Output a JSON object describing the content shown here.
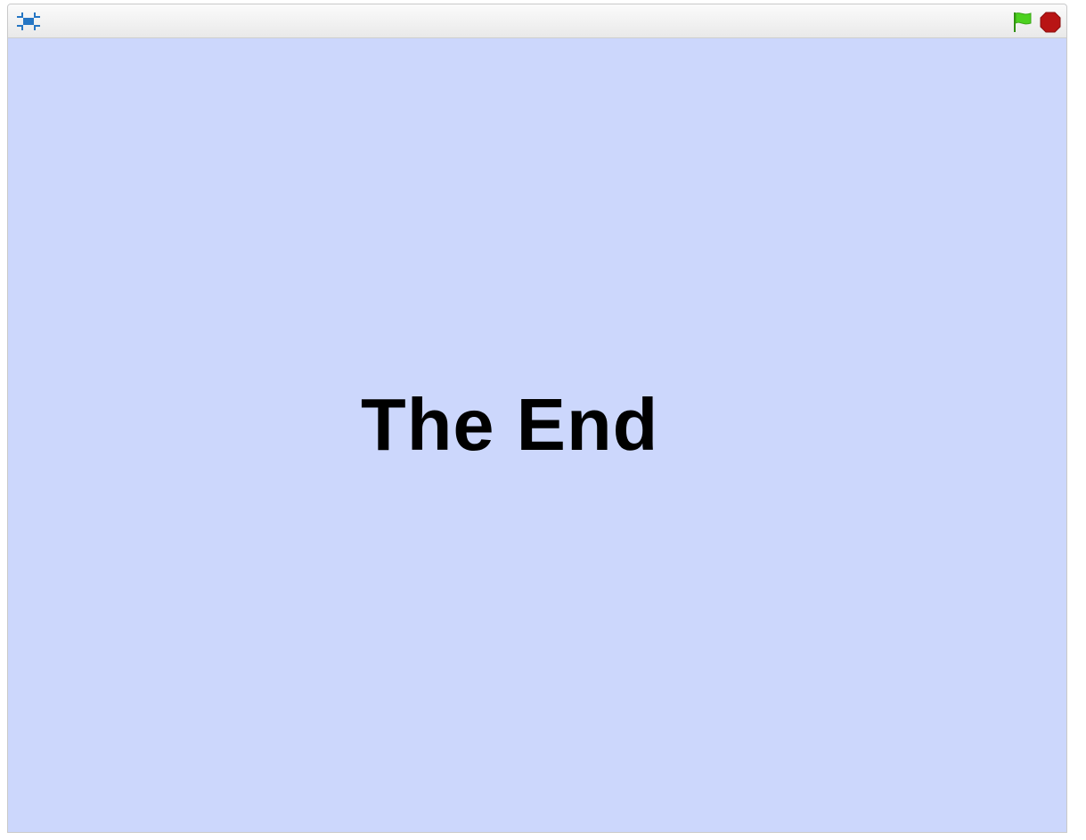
{
  "player": {
    "toolbar": {
      "fullscreen_icon": "fullscreen-icon",
      "green_flag_icon": "green-flag-icon",
      "stop_icon": "stop-sign-icon"
    },
    "stage": {
      "background_color": "#ccd7fc",
      "message": "The End"
    }
  },
  "colors": {
    "accent_blue": "#2576c4",
    "flag_green": "#4cd11f",
    "stop_red": "#b81414"
  }
}
